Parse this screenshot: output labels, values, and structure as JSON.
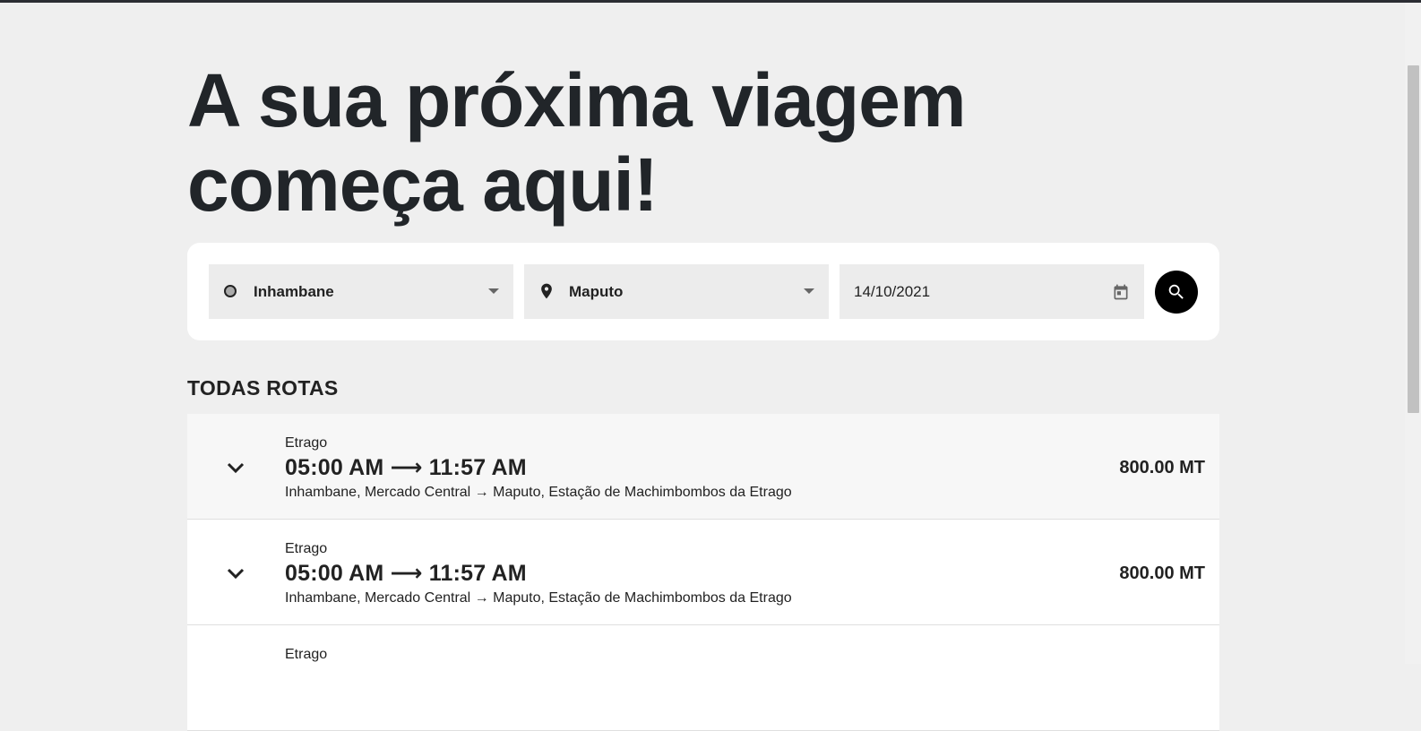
{
  "hero": {
    "title": "A sua próxima viagem começa aqui!"
  },
  "search": {
    "origin": "Inhambane",
    "destination": "Maputo",
    "date": "14/10/2021"
  },
  "section": {
    "title": "TODAS ROTAS"
  },
  "routes": [
    {
      "company": "Etrago",
      "times": "05:00 AM ⟶ 11:57 AM",
      "path": "Inhambane, Mercado Central → Maputo, Estação de Machimbombos da Etrago",
      "price": "800.00 MT"
    },
    {
      "company": "Etrago",
      "times": "05:00 AM ⟶ 11:57 AM",
      "path": "Inhambane, Mercado Central → Maputo, Estação de Machimbombos da Etrago",
      "price": "800.00 MT"
    },
    {
      "company": "Etrago",
      "times": "",
      "path": "",
      "price": ""
    }
  ],
  "icons": {
    "origin": "origin-circle-icon",
    "destination": "map-pin-icon",
    "date": "calendar-icon",
    "search": "search-icon",
    "expand": "chevron-down-icon"
  }
}
